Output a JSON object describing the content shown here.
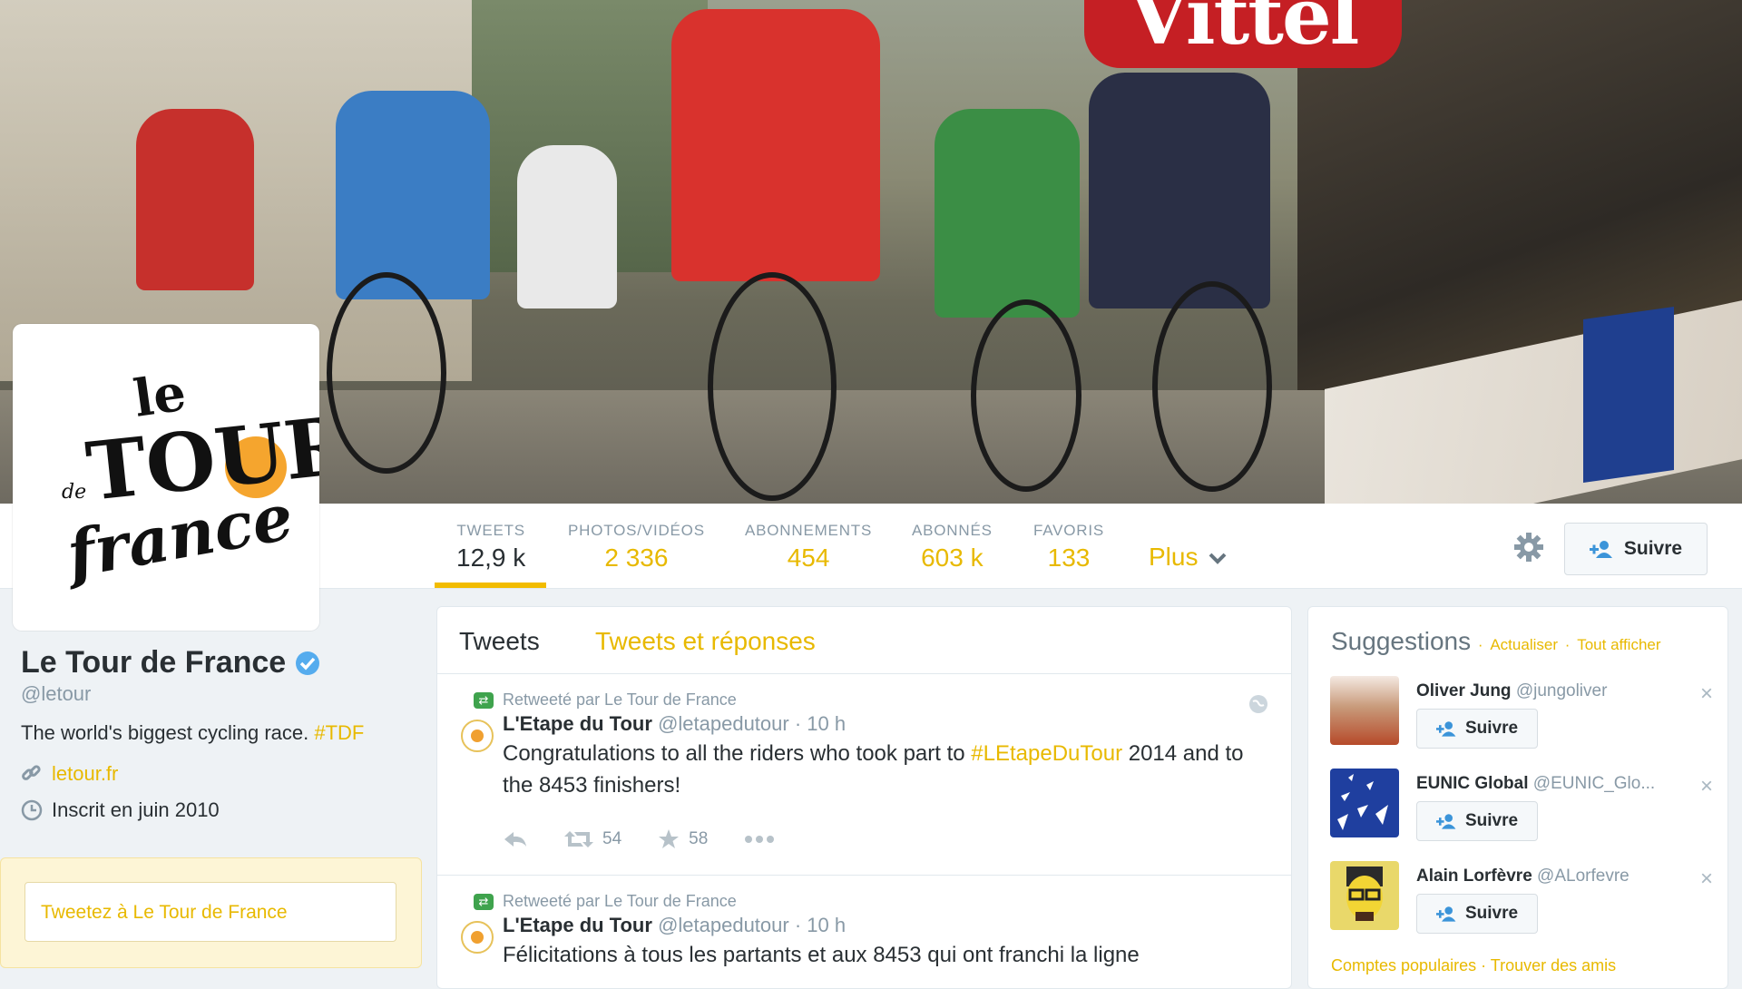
{
  "banner": {
    "sign_text": "Vittel"
  },
  "profile": {
    "name": "Le Tour de France",
    "handle": "@letour",
    "bio_text": "The world's biggest cycling race. ",
    "bio_tag": "#TDF",
    "website": "letour.fr",
    "joined": "Inscrit en juin 2010",
    "tweet_to": "Tweetez à Le Tour de France",
    "logo": {
      "line1": "le",
      "line2": "TOUR",
      "line3": "france",
      "de": "de"
    }
  },
  "stats": [
    {
      "label": "TWEETS",
      "value": "12,9 k"
    },
    {
      "label": "PHOTOS/VIDÉOS",
      "value": "2 336"
    },
    {
      "label": "ABONNEMENTS",
      "value": "454"
    },
    {
      "label": "ABONNÉS",
      "value": "603 k"
    },
    {
      "label": "FAVORIS",
      "value": "133"
    }
  ],
  "nav": {
    "more_label": "Plus",
    "follow_label": "Suivre"
  },
  "timeline": {
    "tabs": [
      "Tweets",
      "Tweets et réponses"
    ],
    "tweets": [
      {
        "retweeted_by": "Retweeté par Le Tour de France",
        "author": "L'Etape du Tour",
        "handle": "@letapedutour",
        "time": "· 10 h",
        "text_before": "Congratulations to all the riders who took part to ",
        "hashtag": "#LEtapeDuTour",
        "text_after": " 2014 and to the 8453 finishers!",
        "retweets": "54",
        "favorites": "58"
      },
      {
        "retweeted_by": "Retweeté par Le Tour de France",
        "author": "L'Etape du Tour",
        "handle": "@letapedutour",
        "time": "· 10 h",
        "text": "Félicitations à tous les partants et aux 8453 qui ont franchi la ligne"
      }
    ]
  },
  "suggestions": {
    "title": "Suggestions",
    "refresh": "Actualiser",
    "view_all": "Tout afficher",
    "separator": "·",
    "items": [
      {
        "name": "Oliver Jung",
        "handle": "@jungoliver",
        "follow": "Suivre",
        "color": "#b64a2a"
      },
      {
        "name": "EUNIC Global",
        "handle": "@EUNIC_Glo...",
        "follow": "Suivre",
        "color": "#1f3f9f"
      },
      {
        "name": "Alain Lorfèvre",
        "handle": "@ALorfevre",
        "follow": "Suivre",
        "color": "#e4c531"
      }
    ],
    "footer_popular": "Comptes populaires",
    "footer_find": "Trouver des amis"
  },
  "colors": {
    "accent": "#e8b900",
    "text": "#292f33",
    "muted": "#8899a6"
  }
}
